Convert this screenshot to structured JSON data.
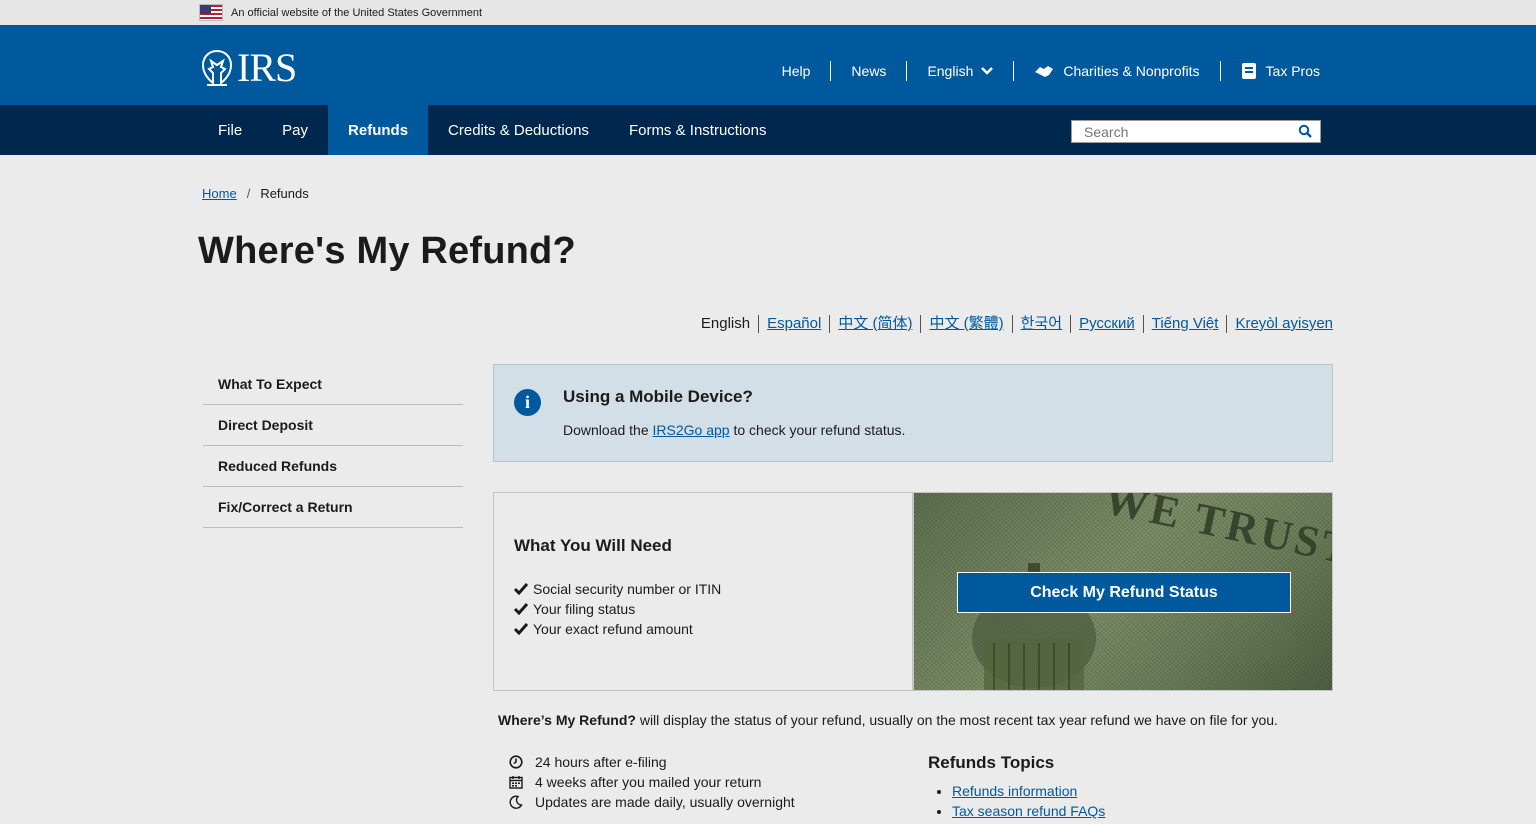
{
  "gov_banner": {
    "text": "An official website of the United States Government"
  },
  "header": {
    "logo_text": "IRS",
    "utility_nav": [
      {
        "label": "Help"
      },
      {
        "label": "News"
      },
      {
        "label": "English"
      },
      {
        "label": "Charities & Nonprofits"
      },
      {
        "label": "Tax Pros"
      }
    ]
  },
  "main_nav": {
    "items": [
      {
        "label": "File"
      },
      {
        "label": "Pay"
      },
      {
        "label": "Refunds"
      },
      {
        "label": "Credits & Deductions"
      },
      {
        "label": "Forms & Instructions"
      }
    ],
    "search_placeholder": "Search"
  },
  "breadcrumb": {
    "home": "Home",
    "separator": "/",
    "current": "Refunds"
  },
  "page_title": "Where's My Refund?",
  "languages": [
    "English",
    "Español",
    "中文 (简体)",
    "中文 (繁體)",
    "한국어",
    "Русский",
    "Tiếng Việt",
    "Kreyòl ayisyen"
  ],
  "sidenav": {
    "items": [
      "What To Expect",
      "Direct Deposit",
      "Reduced Refunds",
      "Fix/Correct a Return"
    ]
  },
  "alert": {
    "title": "Using a Mobile Device?",
    "text_before": "Download the ",
    "link": "IRS2Go app",
    "text_after": " to check your refund status."
  },
  "need": {
    "title": "What You Will Need",
    "items": [
      "Social security number or ITIN",
      "Your filing status",
      "Your exact refund amount"
    ]
  },
  "image_panel": {
    "engraving_text": "WE TRUST",
    "button_label": "Check My Refund Status"
  },
  "summary": {
    "bold": "Where’s My Refund?",
    "rest": " will display the status of your refund, usually on the most recent tax year refund we have on file for you."
  },
  "timing": [
    {
      "icon": "clock-icon",
      "text": "24 hours after e-filing"
    },
    {
      "icon": "calendar-icon",
      "text": "4 weeks after you mailed your return"
    },
    {
      "icon": "moon-icon",
      "text": "Updates are made daily, usually overnight"
    }
  ],
  "topics": {
    "title": "Refunds Topics",
    "links": [
      "Refunds information",
      "Tax season refund FAQs"
    ]
  },
  "colors": {
    "header_blue": "#00599c",
    "nav_navy": "#00284f",
    "page_bg": "#ebebeb",
    "alert_bg": "#d3dfe7"
  }
}
